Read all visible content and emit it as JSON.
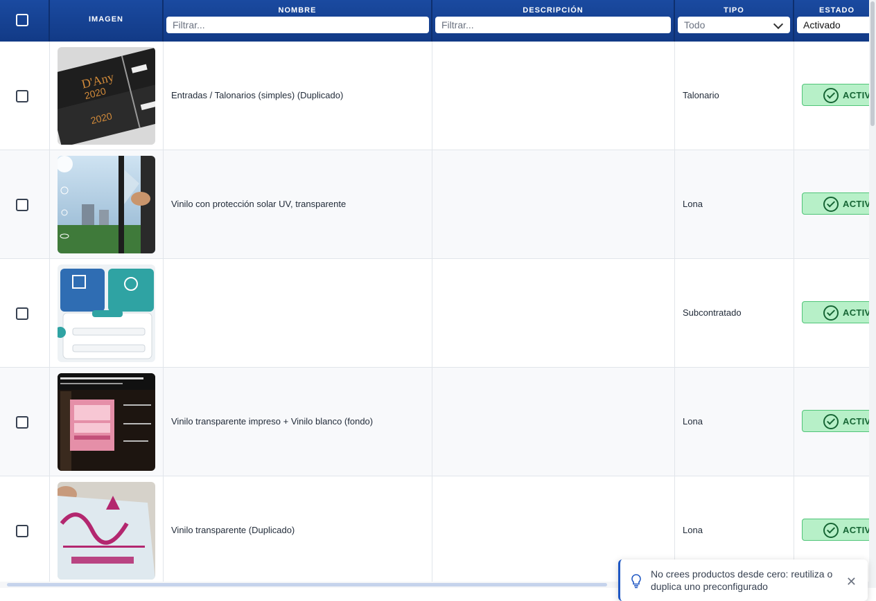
{
  "columns": {
    "imagen": "IMAGEN",
    "nombre": "NOMBRE",
    "descripcion": "DESCRIPCIÓN",
    "tipo": "TIPO",
    "estado": "ESTADO"
  },
  "filters": {
    "nombre_placeholder": "Filtrar...",
    "descripcion_placeholder": "Filtrar...",
    "tipo_selected": "Todo",
    "estado_selected": "Activado"
  },
  "rows": [
    {
      "nombre": "Entradas / Talonarios (simples) (Duplicado)",
      "descripcion": "",
      "tipo": "Talonario",
      "estado": "ACTIVADO",
      "image": "talonario-entradas-photo"
    },
    {
      "nombre": "Vinilo con protección solar UV, transparente",
      "descripcion": "",
      "tipo": "Lona",
      "estado": "ACTIVADO",
      "image": "vinilo-ventana-photo"
    },
    {
      "nombre": "",
      "descripcion": "",
      "tipo": "Subcontratado",
      "estado": "ACTIVADO",
      "image": "productos-servicios-illustration"
    },
    {
      "nombre": "Vinilo transparente impreso + Vinilo blanco (fondo)",
      "descripcion": "",
      "tipo": "Lona",
      "estado": "ACTIVADO",
      "image": "nueva-coleccion-photo"
    },
    {
      "nombre": "Vinilo transparente (Duplicado)",
      "descripcion": "",
      "tipo": "Lona",
      "estado": "ACTIVADO",
      "image": "adhara-sticker-photo"
    }
  ],
  "toast": {
    "message": "No crees productos desde cero: reutiliza o duplica uno preconfigurado",
    "icon": "lightbulb-icon"
  },
  "colors": {
    "header_bg": "#16408f",
    "badge_bg": "#b7f0c8",
    "badge_text": "#166534"
  }
}
